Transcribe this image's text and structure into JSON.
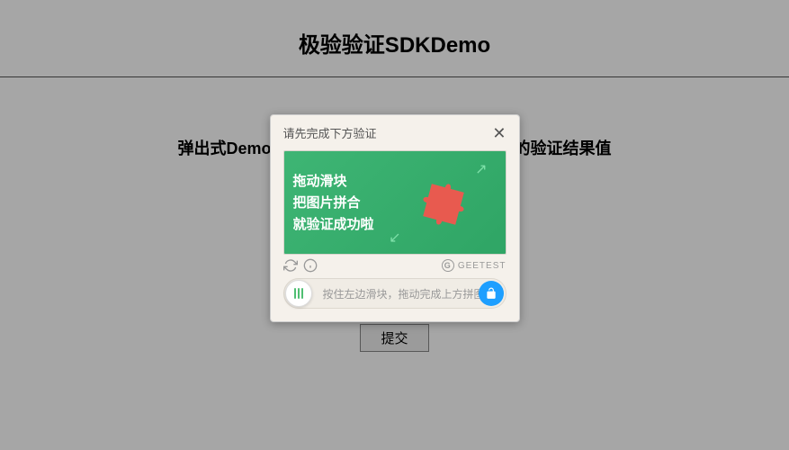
{
  "page": {
    "title": "极验验证SDKDemo",
    "subtitle": "弹出式Demo，使用表单形式提交二次验证所需的验证结果值",
    "submit_label": "提交"
  },
  "captcha": {
    "header_text": "请先完成下方验证",
    "image_text_line1": "拖动滑块",
    "image_text_line2": "把图片拼合",
    "image_text_line3": "就验证成功啦",
    "brand_name": "GEETEST",
    "slider_hint": "按住左边滑块，拖动完成上方拼图"
  }
}
